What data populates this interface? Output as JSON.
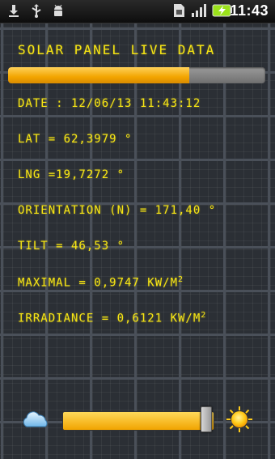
{
  "status_bar": {
    "time": "11:43",
    "icons": [
      "download-icon",
      "usb-icon",
      "android-debug-icon",
      "sim-card-icon",
      "signal-icon",
      "battery-charging-icon"
    ]
  },
  "app": {
    "title": "SOLAR PANEL LIVE DATA",
    "progress_fraction": 0.705,
    "date_line": "DATE : 12/06/13 11:43:12",
    "lat_line": "LAT = 62,3979 °",
    "lng_line": "LNG =19,7272 °",
    "orientation_line": "ORIENTATION (N) = 171,40 °",
    "tilt_line": "TILT = 46,53 °",
    "maximal_line": "MAXIMAL = 0,9747 KW/M",
    "maximal_sup": "2",
    "irradiance_line": "IRRADIANCE = 0,6121 KW/M",
    "irradiance_sup": "2",
    "slider_fraction": 0.95
  },
  "colors": {
    "text": "#f7e514",
    "accent": "#f3a500",
    "panel": "#2b2f35"
  }
}
